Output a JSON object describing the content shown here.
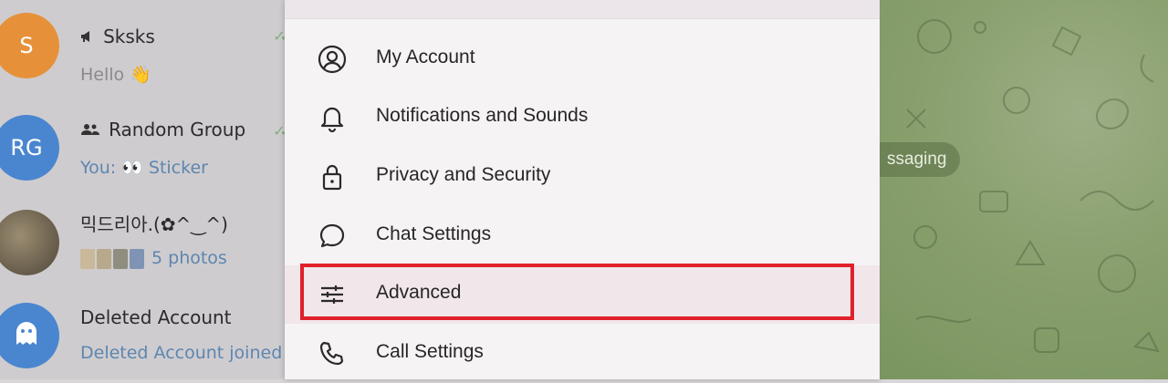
{
  "chat_list": [
    {
      "avatar_text": "S",
      "avatar_color": "#e6913a",
      "title": "Sksks",
      "title_icon": "megaphone-icon",
      "preview": "Hello 👋",
      "preview_accent": false,
      "read_checks": true
    },
    {
      "avatar_text": "RG",
      "avatar_color": "#4a86cf",
      "title": "Random Group",
      "title_icon": "group-icon",
      "preview": "You: 👀 Sticker",
      "preview_accent": true,
      "read_checks": true
    },
    {
      "avatar_text": "",
      "avatar_color": "#6b6150",
      "title": "믹드리아.(✿^‿^)",
      "title_icon": "",
      "preview": "5 photos",
      "preview_accent": true,
      "read_checks": false
    },
    {
      "avatar_text": "",
      "avatar_color": "#4a86cf",
      "title": "Deleted Account",
      "title_icon": "",
      "preview": "Deleted Account joined",
      "preview_accent": true,
      "read_checks": false
    }
  ],
  "settings_menu": {
    "items": [
      {
        "label": "My Account",
        "icon": "account-icon",
        "highlighted": false
      },
      {
        "label": "Notifications and Sounds",
        "icon": "bell-icon",
        "highlighted": false
      },
      {
        "label": "Privacy and Security",
        "icon": "lock-icon",
        "highlighted": false
      },
      {
        "label": "Chat Settings",
        "icon": "chat-bubble-icon",
        "highlighted": false
      },
      {
        "label": "Advanced",
        "icon": "sliders-icon",
        "highlighted": true
      },
      {
        "label": "Call Settings",
        "icon": "phone-icon",
        "highlighted": false
      }
    ]
  },
  "chat_area": {
    "date_pill_text": "ssaging"
  },
  "colors": {
    "highlight_border": "#e0202a",
    "accent_blue": "#5d86b0",
    "chat_bg_green": "#8aa06e"
  }
}
